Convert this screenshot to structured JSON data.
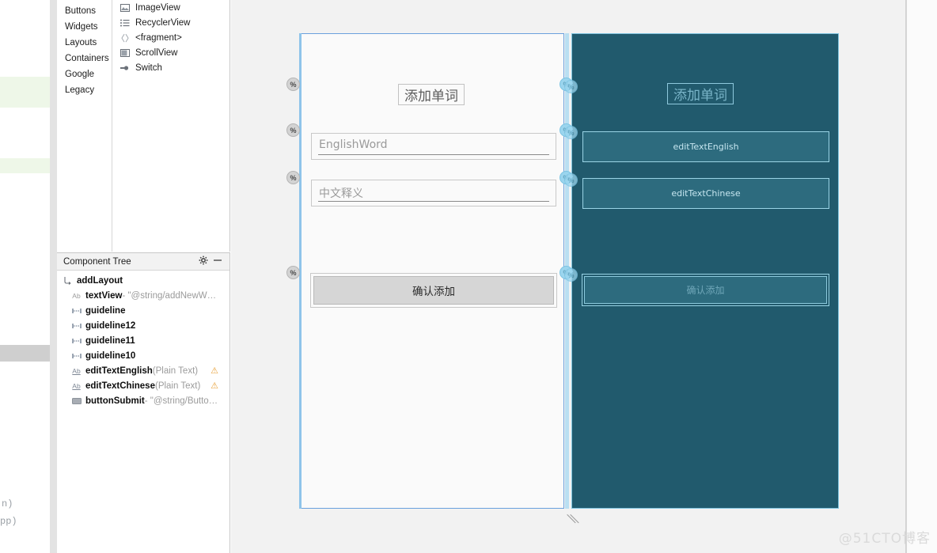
{
  "editor": {
    "visible_code_fragments": [
      "n)",
      "pp)"
    ]
  },
  "palette": {
    "groups": [
      {
        "label": "Buttons"
      },
      {
        "label": "Widgets"
      },
      {
        "label": "Layouts"
      },
      {
        "label": "Containers"
      },
      {
        "label": "Google"
      },
      {
        "label": "Legacy"
      }
    ],
    "items": [
      {
        "label": "ImageView",
        "icon": "image-view-icon",
        "glyph": "⛰"
      },
      {
        "label": "RecyclerView",
        "icon": "recycler-view-icon",
        "glyph": "☰"
      },
      {
        "label": "<fragment>",
        "icon": "fragment-icon",
        "glyph": "‹›"
      },
      {
        "label": "ScrollView",
        "icon": "scroll-view-icon",
        "glyph": "▣"
      },
      {
        "label": "Switch",
        "icon": "switch-icon",
        "glyph": "•"
      }
    ]
  },
  "component_tree": {
    "title": "Component Tree",
    "header_icons": [
      {
        "name": "gear-icon",
        "glyph": "⚙"
      },
      {
        "name": "minimize-icon",
        "glyph": "—"
      }
    ],
    "rows": [
      {
        "icon": "constraint-layout-icon",
        "glyph": "⤵",
        "name": "addLayout",
        "sub": "",
        "indent": 0,
        "warning": false
      },
      {
        "icon": "textview-icon",
        "glyph": "Ab",
        "name": "textView",
        "sub": "- \"@string/addNewW…",
        "indent": 1,
        "warning": false
      },
      {
        "icon": "guideline-icon",
        "glyph": "⇔",
        "name": "guideline",
        "sub": "",
        "indent": 1,
        "warning": false
      },
      {
        "icon": "guideline-icon",
        "glyph": "⇔",
        "name": "guideline12",
        "sub": "",
        "indent": 1,
        "warning": false
      },
      {
        "icon": "guideline-icon",
        "glyph": "⇔",
        "name": "guideline11",
        "sub": "",
        "indent": 1,
        "warning": false
      },
      {
        "icon": "guideline-icon",
        "glyph": "⇔",
        "name": "guideline10",
        "sub": "",
        "indent": 1,
        "warning": false
      },
      {
        "icon": "edittext-icon",
        "glyph": "Ab",
        "name": "editTextEnglish",
        "sub": "(Plain Text)",
        "indent": 1,
        "warning": true
      },
      {
        "icon": "edittext-icon",
        "glyph": "Ab",
        "name": "editTextChinese",
        "sub": "(Plain Text)",
        "indent": 1,
        "warning": true
      },
      {
        "icon": "button-icon",
        "glyph": "■",
        "name": "buttonSubmit",
        "sub": "- \"@string/Butto…",
        "indent": 1,
        "warning": false
      }
    ],
    "warning_glyph": "⚠"
  },
  "design_preview": {
    "title_text": "添加单词",
    "edit_english_placeholder": "EnglishWord",
    "edit_chinese_placeholder": "中文释义",
    "button_label": "确认添加"
  },
  "blueprint_preview": {
    "title_text": "添加单词",
    "edit_english_label": "editTextEnglish",
    "edit_chinese_label": "editTextChinese",
    "button_label": "确认添加"
  },
  "guidelines": {
    "marker_glyph": "%",
    "count": 4
  },
  "colors": {
    "blueprint_bg": "#215a6d",
    "blueprint_widget": "#2d6b7e",
    "blueprint_stroke": "#9ad4e6",
    "selection_blue": "#6aa0dd",
    "guideline_blue": "#9bd5ee",
    "warning_amber": "#e8a33d",
    "editor_highlight": "#eef7e8"
  },
  "watermark": {
    "text": "@51CTO博客"
  }
}
